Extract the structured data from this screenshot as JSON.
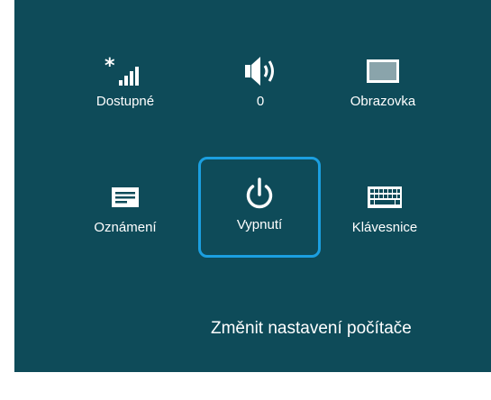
{
  "settings_panel": {
    "tiles": [
      {
        "label": "Dostupné",
        "icon": "network-signal-icon"
      },
      {
        "label": "0",
        "icon": "speaker-volume-icon"
      },
      {
        "label": "Obrazovka",
        "icon": "screen-brightness-icon"
      },
      {
        "label": "Oznámení",
        "icon": "notifications-icon"
      },
      {
        "label": "Vypnutí",
        "icon": "power-icon",
        "selected": true
      },
      {
        "label": "Klávesnice",
        "icon": "keyboard-icon"
      }
    ],
    "change_pc_settings_label": "Změnit nastavení počítače"
  },
  "colors": {
    "panel_background": "#0e4b59",
    "selection_border": "#1b9fe0",
    "text": "#ffffff"
  }
}
